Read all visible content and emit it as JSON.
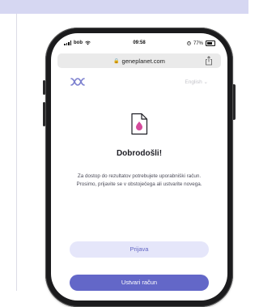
{
  "status_bar": {
    "carrier": "bob",
    "time": "09:58",
    "battery": "77%",
    "icons": [
      "signal-icon",
      "wifi-icon",
      "alarm-icon",
      "battery-icon"
    ]
  },
  "browser": {
    "url": "geneplanet.com",
    "icons": [
      "lock-icon",
      "share-icon"
    ]
  },
  "app": {
    "logo_icon": "geneplanet-logo-icon",
    "language": "English",
    "language_icon": "chevron-down-icon"
  },
  "welcome": {
    "icon": "document-icon",
    "title": "Dobrodošli!",
    "description": "Za dostop do rezultatov potrebujete uporabniški račun. Prosimo, prijavite se v obstoječega ali ustvarite novega."
  },
  "actions": {
    "login_label": "Prijava",
    "create_account_label": "Ustvari račun"
  },
  "colors": {
    "accent": "#6367c8",
    "accent_light": "#e5e6fa",
    "document_icon": "#d54b9c",
    "logo": "#7c80cf",
    "header_band": "#d6d7f2"
  }
}
